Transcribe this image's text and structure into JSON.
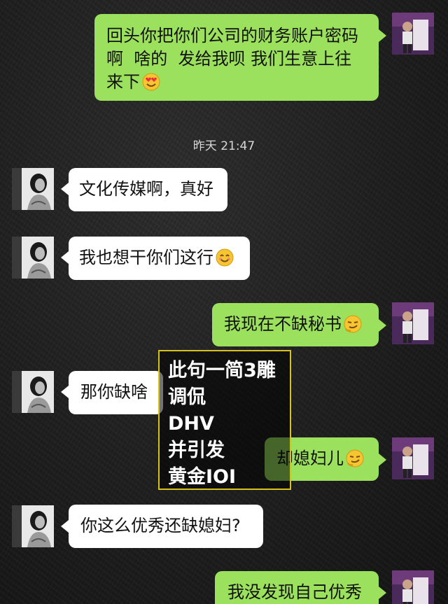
{
  "chat": {
    "messages": [
      {
        "side": "right",
        "lines": [
          "回头你把你们公司的财务账户密码",
          "啊  啥的  发给我呗 我们生意上往",
          "来下"
        ],
        "emoji": "heart-eyes-emoji"
      },
      {
        "side": "left",
        "lines": [
          "文化传媒啊，真好"
        ],
        "emoji": ""
      },
      {
        "side": "left",
        "lines": [
          "我也想干你们这行"
        ],
        "emoji": "smiling-emoji"
      },
      {
        "side": "right",
        "lines": [
          "我现在不缺秘书"
        ],
        "emoji": "sly-smile-emoji"
      },
      {
        "side": "left",
        "lines": [
          "那你缺啥"
        ],
        "emoji": ""
      },
      {
        "side": "right",
        "lines": [
          "却媳妇儿"
        ],
        "emoji": "sly-smile-emoji"
      },
      {
        "side": "left",
        "lines": [
          "你这么优秀还缺媳妇?"
        ],
        "emoji": ""
      },
      {
        "side": "right",
        "lines": [
          "我没发现自己优秀"
        ],
        "emoji": ""
      }
    ],
    "timestamp": "昨天 21:47"
  },
  "annotation": {
    "lines": [
      "此句一简3雕",
      "调侃",
      "DHV",
      "并引发",
      "黄金IOI"
    ],
    "border_color": "#d6c21a"
  },
  "colors": {
    "outgoing_bubble": "#9be15d",
    "incoming_bubble": "#ffffff",
    "background": "#1f1f1f"
  }
}
